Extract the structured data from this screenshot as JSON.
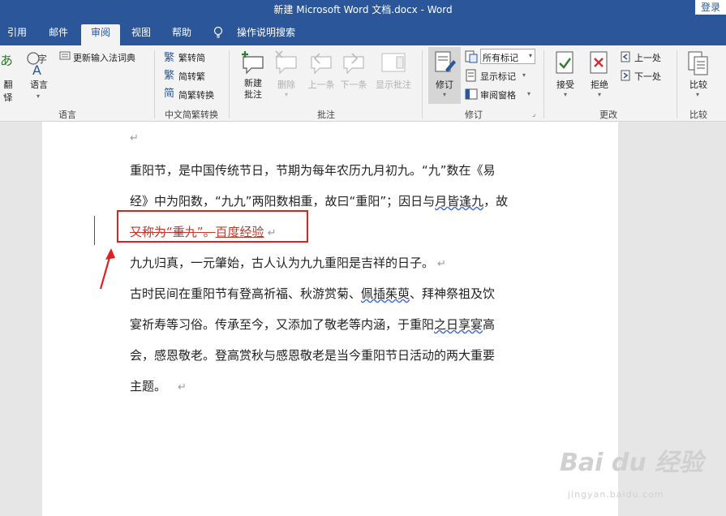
{
  "window": {
    "title": "新建 Microsoft Word 文档.docx  -  Word",
    "login_label": "登录"
  },
  "tabs": [
    {
      "label": "引用"
    },
    {
      "label": "邮件"
    },
    {
      "label": "审阅"
    },
    {
      "label": "视图"
    },
    {
      "label": "帮助"
    },
    {
      "label": "操作说明搜索"
    }
  ],
  "ribbon": {
    "translate_label": "翻译",
    "language_label": "语言",
    "update_ime_label": "更新输入法词典",
    "group_language": "语言",
    "to_simplified": "繁转简",
    "to_traditional": "简转繁",
    "conversion": "简繁转换",
    "group_chinese": "中文简繁转换",
    "new_comment": "新建\n批注",
    "delete": "删除",
    "prev": "上一条",
    "next": "下一条",
    "show_comments": "显示批注",
    "group_comments": "批注",
    "track_changes": "修订",
    "all_markup": "所有标记",
    "show_markup": "显示标记",
    "reviewing_pane": "审阅窗格",
    "group_tracking": "修订",
    "accept": "接受",
    "reject": "拒绝",
    "prev_change": "上一处",
    "next_change": "下一处",
    "group_changes": "更改",
    "compare": "比较",
    "group_compare": "比较"
  },
  "document": {
    "line1": "重阳节，是中国传统节日，节期为每年农历九月初九。“九”数在《易",
    "line2a": "经》中为阳数，“九九”两阳数相重，故曰“重阳”；因日与",
    "line2b": "月皆逢九",
    "line2c": "，故",
    "deleted_text": "又称为“重九”。",
    "inserted_text": "百度经验",
    "line4": "九九归真，一元肇始，古人认为九九重阳是吉祥的日子。",
    "line5a": "古时民间在重阳节有登高祈福、秋游赏菊、",
    "line5b": "佩插茱萸",
    "line5c": "、拜神祭祖及饮",
    "line6a": "宴祈寿等习俗。传承至今，又添加了敬老等内涵，于重阳",
    "line6b": "之日享宴",
    "line6c": "高",
    "line7": "会，感恩敬老。登高赏秋与感恩敬老是当今重阳节日活动的两大重要",
    "line8": "主题。",
    "para_mark": "↵"
  },
  "watermark": {
    "main": "Bai du 经验",
    "sub": "jingyan.baidu.com"
  },
  "colors": {
    "accent": "#2b579a",
    "track_change": "#c0392b",
    "annotation": "#e02020"
  }
}
